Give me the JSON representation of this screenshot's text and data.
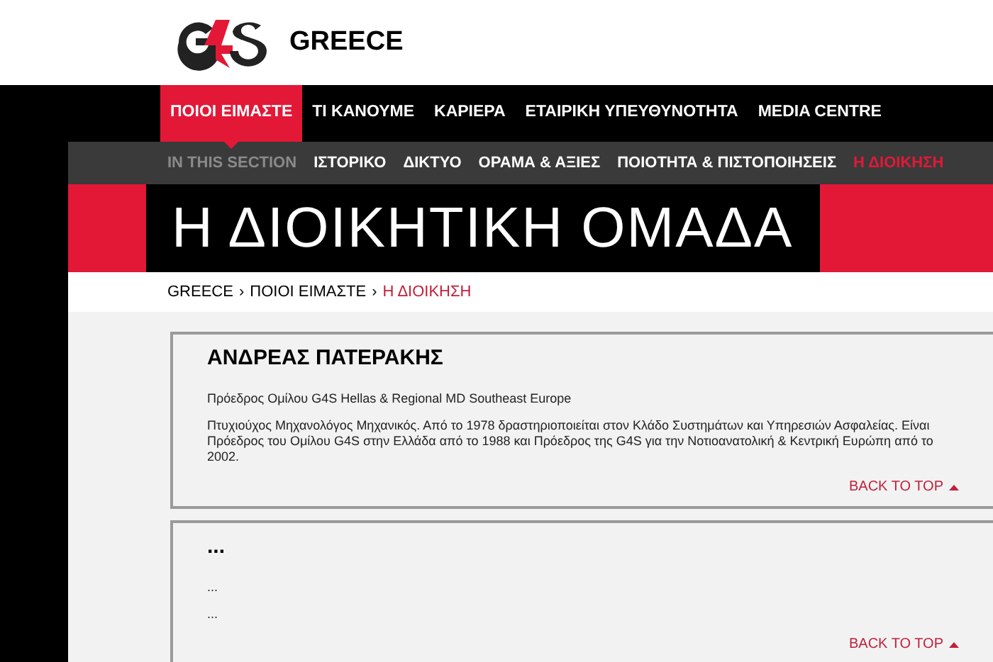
{
  "header": {
    "brand": "GREECE"
  },
  "main_nav": [
    {
      "label": "ΠΟΙΟΙ ΕΙΜΑΣΤΕ",
      "selected": true
    },
    {
      "label": "ΤΙ ΚΑΝΟΥΜΕ",
      "selected": false
    },
    {
      "label": "ΚΑΡΙΕΡΑ",
      "selected": false
    },
    {
      "label": "ΕΤΑΙΡΙΚΗ ΥΠΕΥΘΥΝΟΤΗΤΑ",
      "selected": false
    },
    {
      "label": "MEDIA CENTRE",
      "selected": false
    }
  ],
  "section_nav": {
    "label": "IN THIS SECTION",
    "items": [
      {
        "label": "ΙΣΤΟΡΙΚΟ",
        "selected": false
      },
      {
        "label": "ΔΙΚΤΥΟ",
        "selected": false
      },
      {
        "label": "ΟΡΑΜΑ & ΑΞΙΕΣ",
        "selected": false
      },
      {
        "label": "ΠΟΙΟΤΗΤΑ & ΠΙΣΤΟΠΟΙΗΣΕΙΣ",
        "selected": false
      },
      {
        "label": "Η ΔΙΟΙΚΗΣΗ",
        "selected": true
      }
    ]
  },
  "page_title": "Η ΔΙΟΙΚΗΤΙΚΗ ΟΜΑΔΑ",
  "breadcrumb": [
    {
      "kind": "link",
      "text": "GREECE",
      "selected": false
    },
    {
      "kind": "separator",
      "text": "›"
    },
    {
      "kind": "link",
      "text": "ΠΟΙΟΙ ΕΙΜΑΣΤΕ",
      "selected": false
    },
    {
      "kind": "separator",
      "text": "›"
    },
    {
      "kind": "link",
      "text": "Η ΔΙΟΙΚΗΣΗ",
      "selected": true
    }
  ],
  "cards": [
    {
      "name": "ΑΝΔΡΕΑΣ ΠΑΤΕΡΑΚΗΣ",
      "role": "Πρόεδρος Ομίλου G4S Hellas & Regional MD Southeast Europe",
      "bio": "Πτυχιούχος Μηχανολόγος Μηχανικός. Από το 1978 δραστηριοποιείται στον Κλάδο Συστημάτων και Υπηρεσιών Ασφαλείας. Είναι Πρόεδρος του Ομίλου G4S στην Ελλάδα από το 1988 και Πρόεδρος της G4S για την Νοτιοανατολική & Κεντρική Ευρώπη από το 2002.",
      "back_to_top": "BACK TO TOP"
    },
    {
      "name": "...",
      "role": "...",
      "bio": "...",
      "back_to_top": "BACK TO TOP"
    }
  ]
}
